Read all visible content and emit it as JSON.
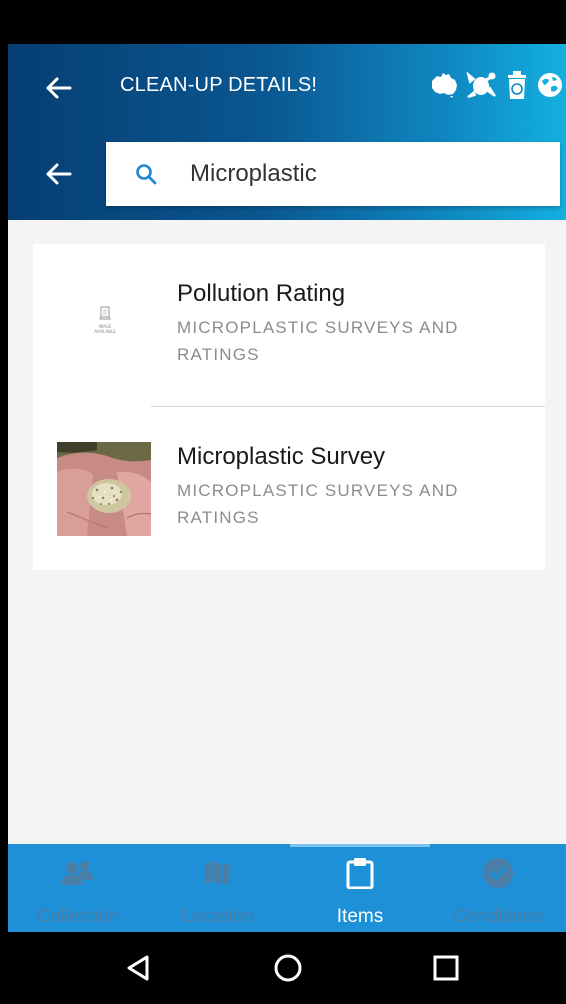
{
  "header": {
    "title": "CLEAN-UP DETAILS!",
    "brand_icons": [
      "australia-map-icon",
      "turtle-icon",
      "recycle-bin-icon",
      "globe-icon"
    ]
  },
  "search": {
    "value": "Microplastic",
    "placeholder": ""
  },
  "results": [
    {
      "title": "Pollution Rating",
      "subtitle": "MICROPLASTIC SURVEYS AND RATINGS",
      "thumbnail": "no-image-placeholder",
      "thumbnail_text": "IMAGE\nAVAILABLE"
    },
    {
      "title": "Microplastic Survey",
      "subtitle": "MICROPLASTIC SURVEYS AND RATINGS",
      "thumbnail": "hand-with-microplastics-photo"
    }
  ],
  "tabs": [
    {
      "label": "Collection",
      "icon": "people-icon",
      "active": false
    },
    {
      "label": "Location",
      "icon": "map-icon",
      "active": false
    },
    {
      "label": "Items",
      "icon": "clipboard-icon",
      "active": true
    },
    {
      "label": "Conditions",
      "icon": "check-circle-icon",
      "active": false
    }
  ],
  "nav": [
    "back-triangle-icon",
    "home-circle-icon",
    "recents-square-icon"
  ],
  "colors": {
    "header_dark": "#063e72",
    "header_light": "#14b0e0",
    "tab_bar": "#1e90d8",
    "tab_inactive": "#4a7ea7",
    "search_icon": "#1e88d0"
  }
}
